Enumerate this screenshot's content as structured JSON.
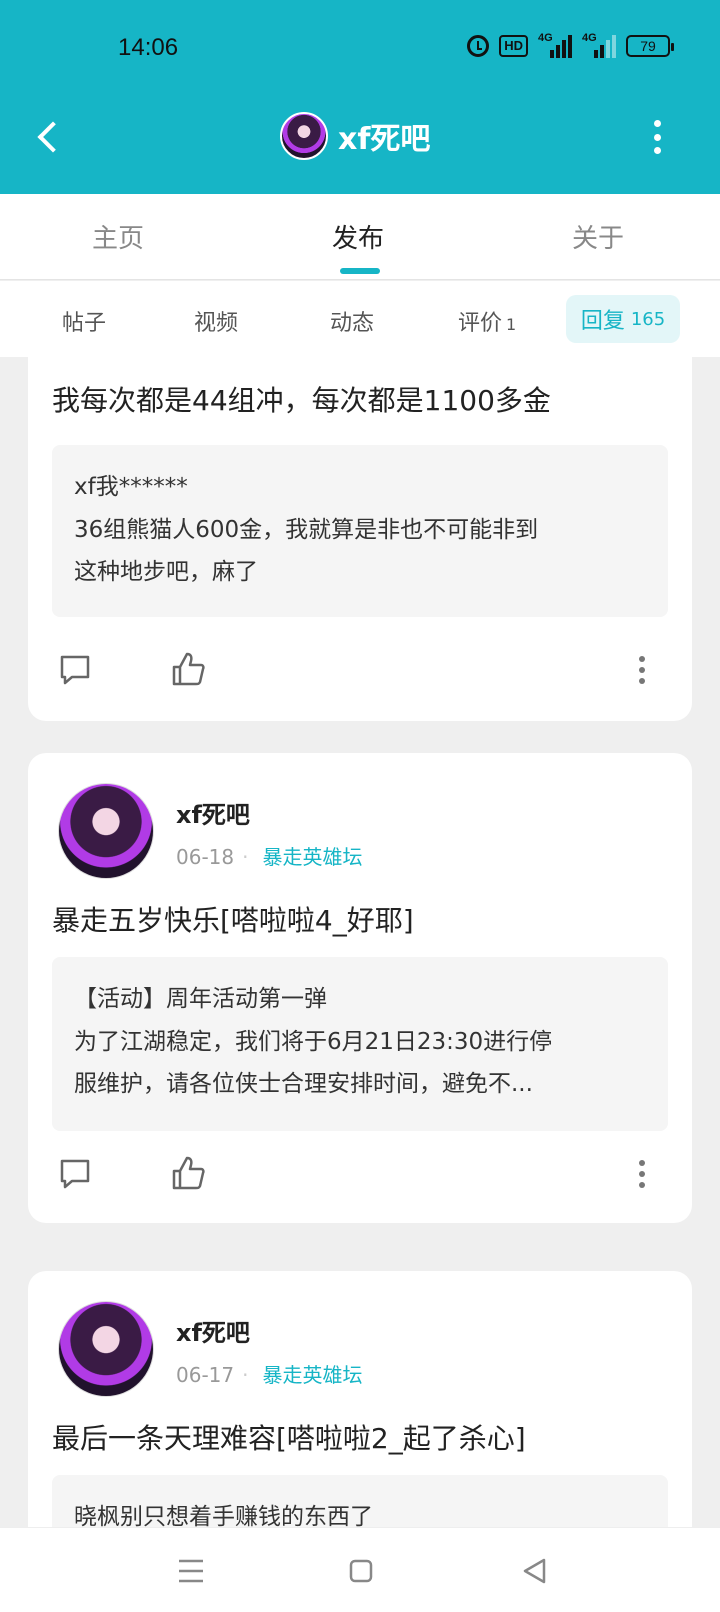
{
  "status_bar": {
    "time": "14:06",
    "hd_label": "HD",
    "network_1": "4G",
    "network_2": "4G",
    "battery": "79"
  },
  "header": {
    "title": "xf死吧"
  },
  "tabs": [
    {
      "label": "主页"
    },
    {
      "label": "发布"
    },
    {
      "label": "关于"
    }
  ],
  "subtabs": {
    "posts": "帖子",
    "videos": "视频",
    "moments": "动态",
    "reviews": "评价",
    "reviews_count": "1",
    "replies": "回复",
    "replies_count": "165"
  },
  "cards": [
    {
      "text": "我每次都是44组冲，每次都是1100多金",
      "quote_title": "xf我******",
      "quote_line1": "36组熊猫人600金，我就算是非也不可能非到",
      "quote_line2": "这种地步吧，麻了"
    },
    {
      "author": "xf死吧",
      "date": "06-18",
      "separator": "·",
      "forum": "暴走英雄坛",
      "text": "暴走五岁快乐[嗒啦啦4_好耶]",
      "quote_title": "【活动】周年活动第一弹",
      "quote_line1": "为了江湖稳定，我们将于6月21日23:30进行停",
      "quote_line2": "服维护，请各位侠士合理安排时间，避免不..."
    },
    {
      "author": "xf死吧",
      "date": "06-17",
      "separator": "·",
      "forum": "暴走英雄坛",
      "text": "最后一条天理难容[嗒啦啦2_起了杀心]",
      "quote_title": "晓枫别只想着手赚钱的东西了"
    }
  ],
  "colors": {
    "accent": "#16b5c6",
    "header_bg": "#16b5c6",
    "page_bg": "#efefef"
  }
}
